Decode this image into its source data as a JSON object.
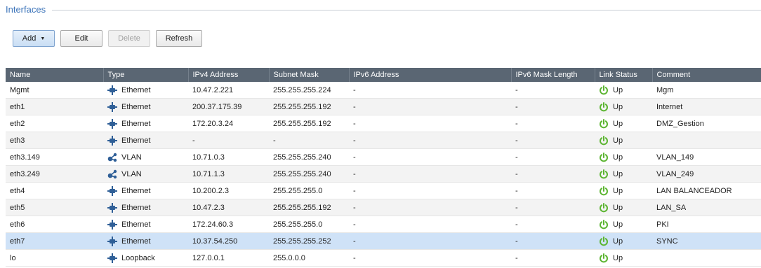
{
  "section": {
    "title": "Interfaces"
  },
  "toolbar": {
    "add_label": "Add",
    "edit_label": "Edit",
    "delete_label": "Delete",
    "refresh_label": "Refresh"
  },
  "columns": [
    "Name",
    "Type",
    "IPv4 Address",
    "Subnet Mask",
    "IPv6 Address",
    "IPv6 Mask Length",
    "Link Status",
    "Comment"
  ],
  "colors": {
    "header_bg": "#5a6673",
    "selected_row": "#cfe2f7",
    "status_green": "#5cb531",
    "type_icon": "#2f5f97"
  },
  "rows": [
    {
      "name": "Mgmt",
      "type": "Ethernet",
      "type_icon": "ethernet-icon",
      "ipv4": "10.47.2.221",
      "mask": "255.255.255.224",
      "ipv6": "-",
      "ipv6_len": "-",
      "status": "Up",
      "comment": "Mgm"
    },
    {
      "name": "eth1",
      "type": "Ethernet",
      "type_icon": "ethernet-icon",
      "ipv4": "200.37.175.39",
      "mask": "255.255.255.192",
      "ipv6": "-",
      "ipv6_len": "-",
      "status": "Up",
      "comment": "Internet"
    },
    {
      "name": "eth2",
      "type": "Ethernet",
      "type_icon": "ethernet-icon",
      "ipv4": "172.20.3.24",
      "mask": "255.255.255.192",
      "ipv6": "-",
      "ipv6_len": "-",
      "status": "Up",
      "comment": "DMZ_Gestion"
    },
    {
      "name": "eth3",
      "type": "Ethernet",
      "type_icon": "ethernet-icon",
      "ipv4": "-",
      "mask": "-",
      "ipv6": "-",
      "ipv6_len": "-",
      "status": "Up",
      "comment": ""
    },
    {
      "name": "eth3.149",
      "type": "VLAN",
      "type_icon": "vlan-icon",
      "ipv4": "10.71.0.3",
      "mask": "255.255.255.240",
      "ipv6": "-",
      "ipv6_len": "-",
      "status": "Up",
      "comment": "VLAN_149"
    },
    {
      "name": "eth3.249",
      "type": "VLAN",
      "type_icon": "vlan-icon",
      "ipv4": "10.71.1.3",
      "mask": "255.255.255.240",
      "ipv6": "-",
      "ipv6_len": "-",
      "status": "Up",
      "comment": "VLAN_249"
    },
    {
      "name": "eth4",
      "type": "Ethernet",
      "type_icon": "ethernet-icon",
      "ipv4": "10.200.2.3",
      "mask": "255.255.255.0",
      "ipv6": "-",
      "ipv6_len": "-",
      "status": "Up",
      "comment": "LAN BALANCEADOR"
    },
    {
      "name": "eth5",
      "type": "Ethernet",
      "type_icon": "ethernet-icon",
      "ipv4": "10.47.2.3",
      "mask": "255.255.255.192",
      "ipv6": "-",
      "ipv6_len": "-",
      "status": "Up",
      "comment": "LAN_SA"
    },
    {
      "name": "eth6",
      "type": "Ethernet",
      "type_icon": "ethernet-icon",
      "ipv4": "172.24.60.3",
      "mask": "255.255.255.0",
      "ipv6": "-",
      "ipv6_len": "-",
      "status": "Up",
      "comment": "PKI"
    },
    {
      "name": "eth7",
      "type": "Ethernet",
      "type_icon": "ethernet-icon",
      "ipv4": "10.37.54.250",
      "mask": "255.255.255.252",
      "ipv6": "-",
      "ipv6_len": "-",
      "status": "Up",
      "comment": "SYNC",
      "selected": true
    },
    {
      "name": "lo",
      "type": "Loopback",
      "type_icon": "loopback-icon",
      "ipv4": "127.0.0.1",
      "mask": "255.0.0.0",
      "ipv6": "-",
      "ipv6_len": "-",
      "status": "Up",
      "comment": ""
    }
  ]
}
